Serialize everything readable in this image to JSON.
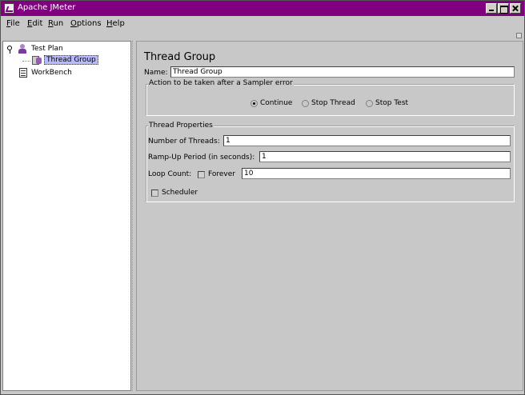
{
  "window": {
    "title": "Apache JMeter",
    "colors": {
      "titlebar": "#800080",
      "selection": "#b8b8ff",
      "background": "#c8c8c8"
    }
  },
  "menu": {
    "items": [
      "File",
      "Edit",
      "Run",
      "Options",
      "Help"
    ]
  },
  "tree": {
    "items": [
      {
        "label": "Test Plan",
        "icon": "test-plan-icon"
      },
      {
        "label": "Thread Group",
        "icon": "thread-group-icon",
        "selected": true
      },
      {
        "label": "WorkBench",
        "icon": "workbench-icon"
      }
    ]
  },
  "panel": {
    "title": "Thread Group",
    "name_label": "Name:",
    "name_value": "Thread Group",
    "error_action": {
      "legend": "Action to be taken after a Sampler error",
      "options": [
        "Continue",
        "Stop Thread",
        "Stop Test"
      ],
      "selected": "Continue"
    },
    "thread_props": {
      "legend": "Thread Properties",
      "threads_label": "Number of Threads:",
      "threads_value": "1",
      "rampup_label": "Ramp-Up Period (in seconds):",
      "rampup_value": "1",
      "loop_label": "Loop Count:",
      "forever_label": "Forever",
      "forever_checked": false,
      "loop_value": "10",
      "scheduler_label": "Scheduler",
      "scheduler_checked": false
    }
  }
}
